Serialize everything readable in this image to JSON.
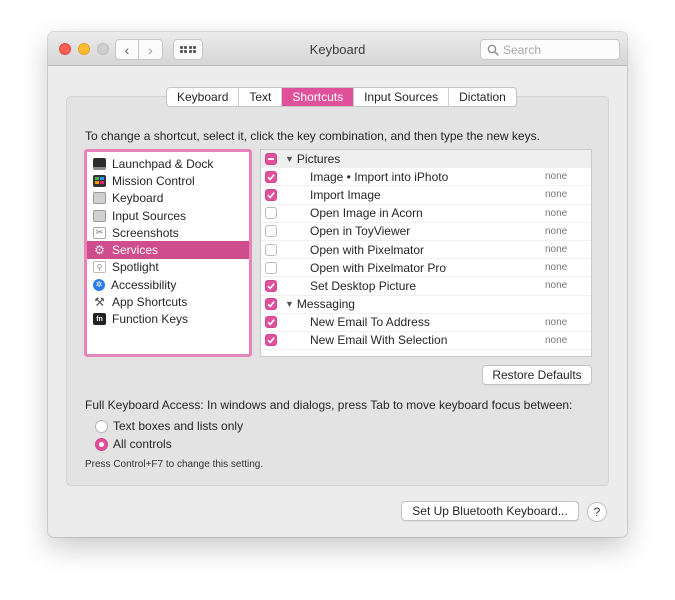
{
  "window": {
    "title": "Keyboard",
    "search_placeholder": "Search"
  },
  "tabs": [
    {
      "label": "Keyboard",
      "active": false
    },
    {
      "label": "Text",
      "active": false
    },
    {
      "label": "Shortcuts",
      "active": true
    },
    {
      "label": "Input Sources",
      "active": false
    },
    {
      "label": "Dictation",
      "active": false
    }
  ],
  "instruction": "To change a shortcut, select it, click the key combination, and then type the new keys.",
  "categories": [
    {
      "label": "Launchpad & Dock",
      "icon": "launchpad-icon",
      "selected": false
    },
    {
      "label": "Mission Control",
      "icon": "mission-control-icon",
      "selected": false
    },
    {
      "label": "Keyboard",
      "icon": "keyboard-icon",
      "selected": false
    },
    {
      "label": "Input Sources",
      "icon": "input-sources-icon",
      "selected": false
    },
    {
      "label": "Screenshots",
      "icon": "screenshot-icon",
      "selected": false
    },
    {
      "label": "Services",
      "icon": "gear-icon",
      "selected": true
    },
    {
      "label": "Spotlight",
      "icon": "spotlight-icon",
      "selected": false
    },
    {
      "label": "Accessibility",
      "icon": "accessibility-icon",
      "selected": false
    },
    {
      "label": "App Shortcuts",
      "icon": "app-shortcuts-icon",
      "selected": false
    },
    {
      "label": "Function Keys",
      "icon": "fn-key-icon",
      "selected": false
    }
  ],
  "shortcuts": [
    {
      "type": "group",
      "name": "Pictures",
      "state": "mixed"
    },
    {
      "type": "item",
      "name": "Image • Import into iPhoto",
      "keys": "none",
      "checked": true
    },
    {
      "type": "item",
      "name": "Import Image",
      "keys": "none",
      "checked": true
    },
    {
      "type": "item",
      "name": "Open Image in Acorn",
      "keys": "none",
      "checked": false
    },
    {
      "type": "item",
      "name": "Open in ToyViewer",
      "keys": "none",
      "checked": false
    },
    {
      "type": "item",
      "name": "Open with Pixelmator",
      "keys": "none",
      "checked": false
    },
    {
      "type": "item",
      "name": "Open with Pixelmator Pro",
      "keys": "none",
      "checked": false
    },
    {
      "type": "item",
      "name": "Set Desktop Picture",
      "keys": "none",
      "checked": true
    },
    {
      "type": "group",
      "name": "Messaging",
      "state": "checked"
    },
    {
      "type": "item",
      "name": "New Email To Address",
      "keys": "none",
      "checked": true
    },
    {
      "type": "item",
      "name": "New Email With Selection",
      "keys": "none",
      "checked": true
    }
  ],
  "buttons": {
    "restore_defaults": "Restore Defaults",
    "setup_bluetooth": "Set Up Bluetooth Keyboard...",
    "help": "?"
  },
  "full_keyboard_access": {
    "label": "Full Keyboard Access: In windows and dialogs, press Tab to move keyboard focus between:",
    "options": [
      {
        "label": "Text boxes and lists only",
        "selected": false
      },
      {
        "label": "All controls",
        "selected": true
      }
    ],
    "hint": "Press Control+F7 to change this setting."
  },
  "colors": {
    "accent": "#e0519c",
    "selection": "#cf4d8c",
    "focus_ring": "#e784b8"
  }
}
